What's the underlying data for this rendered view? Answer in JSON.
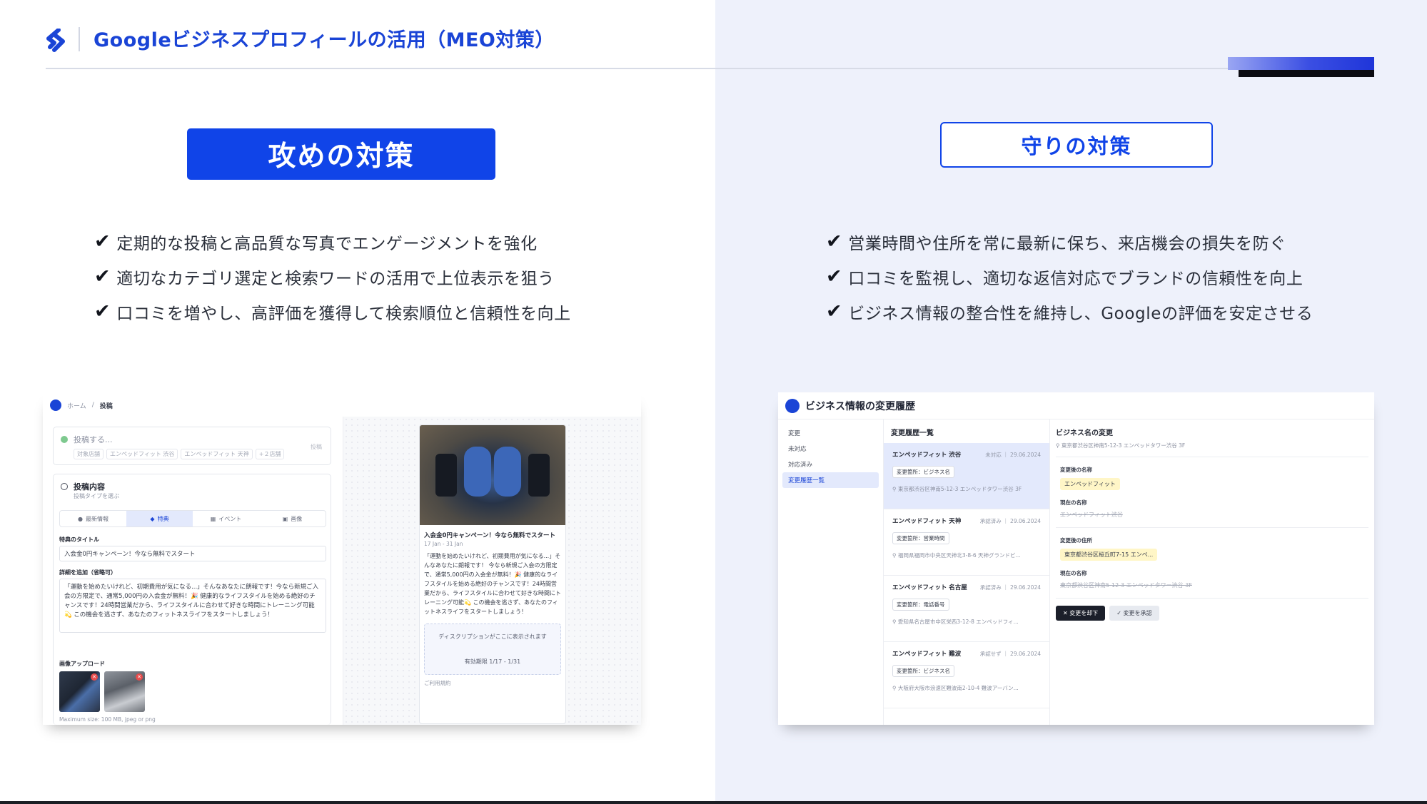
{
  "header": {
    "title": "Googleビジネスプロフィールの活用（MEO対策）"
  },
  "offense": {
    "label": "攻めの対策",
    "bullets": [
      "定期的な投稿と高品質な写真でエンゲージメントを強化",
      "適切なカテゴリ選定と検索ワードの活用で上位表示を狙う",
      "口コミを増やし、高評価を獲得して検索順位と信頼性を向上"
    ]
  },
  "defense": {
    "label": "守りの対策",
    "bullets": [
      "営業時間や住所を常に最新に保ち、来店機会の損失を防ぐ",
      "口コミを監視し、適切な返信対応でブランドの信頼性を向上",
      "ビジネス情報の整合性を維持し、Googleの評価を安定させる"
    ]
  },
  "check_mark": "✔",
  "post_screen": {
    "breadcrumb_home": "ホーム",
    "breadcrumb_sep": "/",
    "breadcrumb_current": "投稿",
    "compose_placeholder": "投稿する...",
    "compose_tags": [
      "対象店舗",
      "エンペッドフィット 渋谷",
      "エンペッドフィット 天神",
      "+２店舗"
    ],
    "compose_button": "投稿",
    "content_title": "投稿内容",
    "content_subtitle": "投稿タイプを選ぶ",
    "type_tabs": [
      "最新情報",
      "特典",
      "イベント",
      "画像"
    ],
    "title_label": "特典のタイトル",
    "title_value": "入会金0円キャンペーン！今なら無料でスタート",
    "detail_label": "詳細を追加（省略可）",
    "detail_value": "「運動を始めたいけれど、初期費用が気になる...」そんなあなたに朗報です！今なら新規ご入会の方限定で、通常5,000円の入会金が無料！🎉 健康的なライフスタイルを始める絶好のチャンスです！24時間営業だから、ライフスタイルに合わせて好きな時間にトレーニング可能💫 この機会を逃さず、あなたのフィットネスライフをスタートしましょう！",
    "upload_label": "画像アップロード",
    "max_size": "Maximum size: 100 MB, jpeg or png",
    "preview_title": "入会金0円キャンペーン！今なら無料でスタート",
    "preview_date": "17 Jan - 31 Jan",
    "preview_body": "「運動を始めたいけれど、初期費用が気になる...」そんなあなたに朗報です！ 今なら新規ご入会の方限定で、通常5,000円の入会金が無料！🎉 健康的なライフスタイルを始める絶好のチャンスです！24時間営業だから、ライフスタイルに合わせて好きな時間にトレーニング可能💫 この機会を逃さず、あなたのフィットネスライフをスタートしましょう！",
    "preview_desc": "ディスクリプションがここに表示されます",
    "preview_validity": "有効期限 1/17 - 1/31",
    "preview_link": "ご利用規約"
  },
  "history_screen": {
    "title": "ビジネス情報の変更履歴",
    "side_items": [
      "変更",
      "未対応",
      "対応済み",
      "変更履歴一覧"
    ],
    "list_title": "変更履歴一覧",
    "items": [
      {
        "name": "エンペッドフィット 渋谷",
        "status": "未対応 ｜ 29.06.2024",
        "badge": "変更箇所：ビジネス名",
        "address": "東京都渋谷区神南5-12-3 エンペッドタワー渋谷 3F"
      },
      {
        "name": "エンペッドフィット 天神",
        "status": "承認済み ｜ 29.06.2024",
        "badge": "変更箇所：営業時間",
        "address": "福岡県福岡市中央区天神北3-8-6 天神グランドビ..."
      },
      {
        "name": "エンペッドフィット 名古屋",
        "status": "承認済み ｜ 29.06.2024",
        "badge": "変更箇所：電話番号",
        "address": "愛知県名古屋市中区栄西3-12-8 エンペッドフィ..."
      },
      {
        "name": "エンペッドフィット 難波",
        "status": "承認せず ｜ 29.06.2024",
        "badge": "変更箇所：ビジネス名",
        "address": "大阪府大阪市浪速区難波南2-10-4 難波アーバン..."
      }
    ],
    "detail_title": "ビジネス名の変更",
    "detail_address": "東京都渋谷区神南5-12-3 エンペッドタワー渋谷 3F",
    "new_name_label": "変更後の名称",
    "new_name_value": "エンペッドフィット",
    "cur_name_label": "現在の名称",
    "cur_name_value": "エンペッドフィット渋谷",
    "new_addr_label": "変更後の住所",
    "new_addr_value": "東京都渋谷区桜丘町7-15 エンペ...",
    "cur_addr_label": "現在の名称",
    "cur_addr_value": "東京都渋谷区神南5-12-3 エンペッドタワー渋谷 3F",
    "reject_label": "変更を却下",
    "approve_label": "変更を承認"
  },
  "colors": {
    "brand_blue": "#1044e8",
    "title_blue": "#1a44d6",
    "right_panel_bg": "#eef1fb"
  }
}
